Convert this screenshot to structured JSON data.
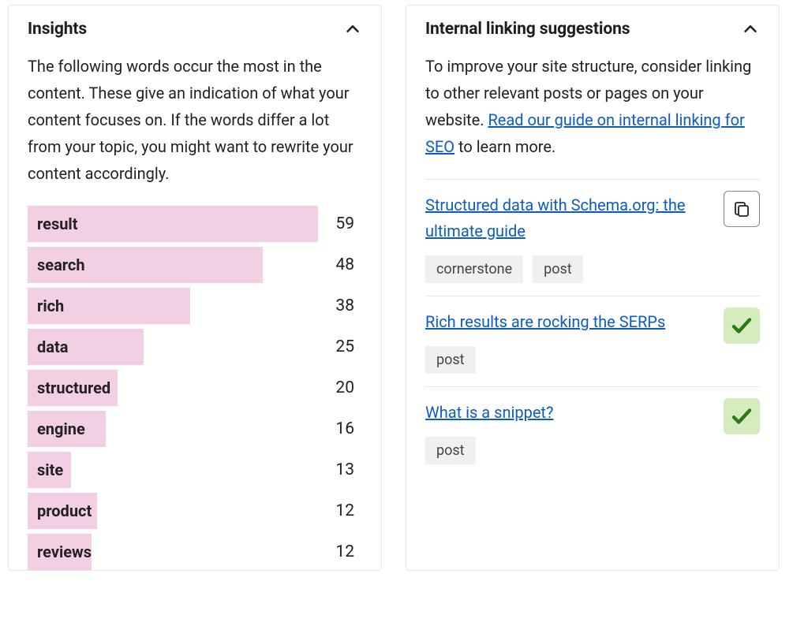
{
  "insights": {
    "title": "Insights",
    "description": "The following words occur the most in the content. These give an indication of what your content focuses on. If the words differ a lot from your topic, you might want to rewrite your content accordingly.",
    "bar_color": "#f2cfe2",
    "max_value": 59,
    "words": [
      {
        "label": "result",
        "count": 59,
        "pct": 100
      },
      {
        "label": "search",
        "count": 48,
        "pct": 81
      },
      {
        "label": "rich",
        "count": 38,
        "pct": 56
      },
      {
        "label": "data",
        "count": 25,
        "pct": 40
      },
      {
        "label": "structured",
        "count": 20,
        "pct": 31
      },
      {
        "label": "engine",
        "count": 16,
        "pct": 27
      },
      {
        "label": "site",
        "count": 13,
        "pct": 15
      },
      {
        "label": "product",
        "count": 12,
        "pct": 24
      },
      {
        "label": "reviews",
        "count": 12,
        "pct": 22
      }
    ]
  },
  "linking": {
    "title": "Internal linking suggestions",
    "description_pre": "To improve your site structure, consider linking to other relevant posts or pages on your website. ",
    "description_link": "Read our guide on internal linking for SEO",
    "description_post": " to learn more.",
    "link_color": "#0b5cc4",
    "suggestions": [
      {
        "title": "Structured data with Schema.org: the ultimate guide",
        "tags": [
          "cornerstone",
          "post"
        ],
        "action": "copy"
      },
      {
        "title": "Rich results are rocking the SERPs",
        "tags": [
          "post"
        ],
        "action": "check"
      },
      {
        "title": "What is a snippet?",
        "tags": [
          "post"
        ],
        "action": "check"
      }
    ]
  }
}
